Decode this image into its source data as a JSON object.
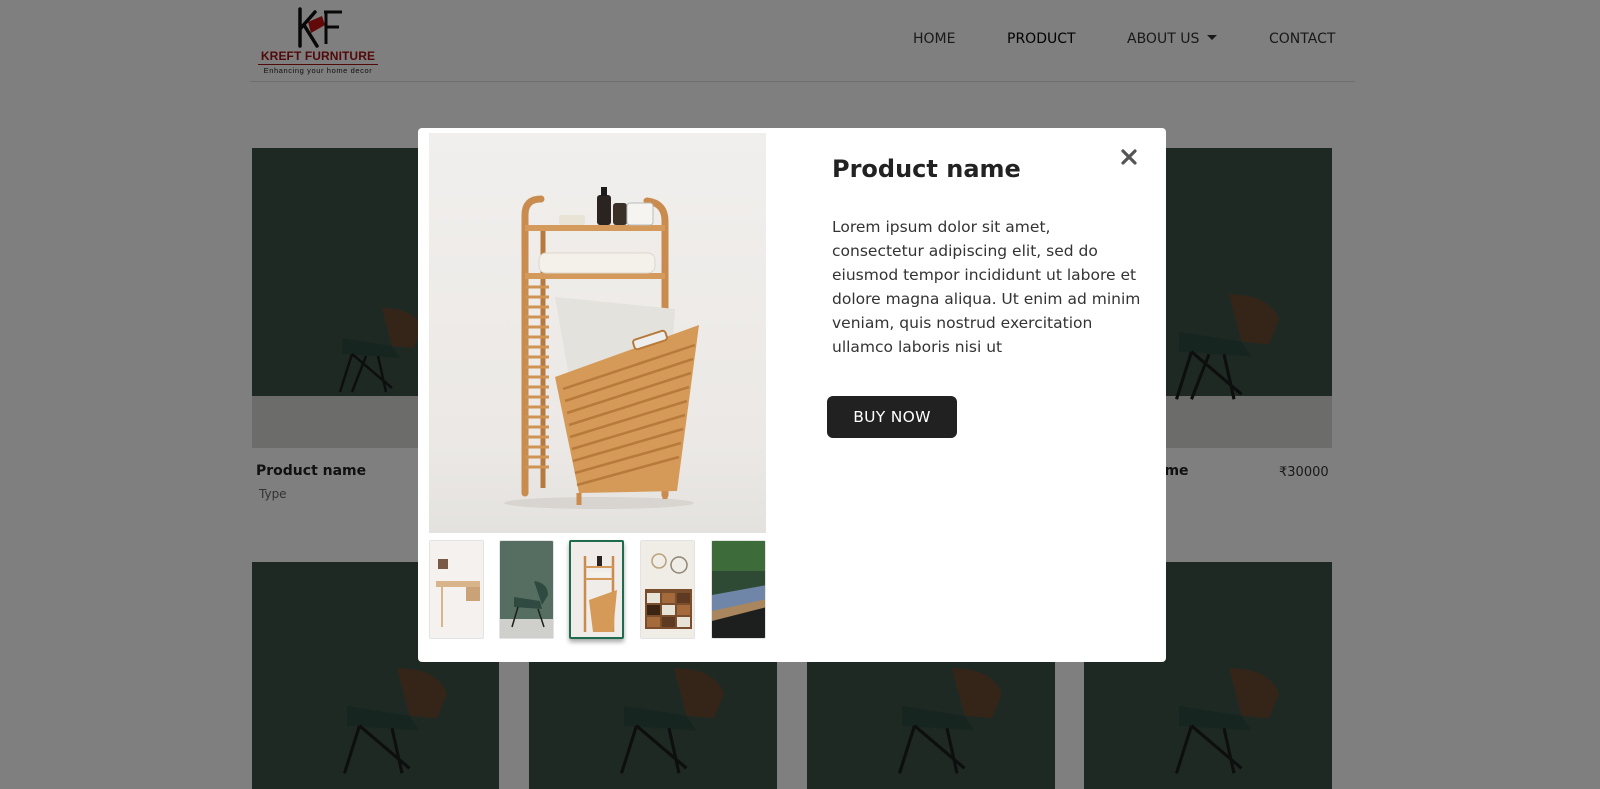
{
  "brand": {
    "name": "KREFT FURNITURE",
    "tagline": "Enhancing your home decor",
    "logo_letters": "KF",
    "brand_color": "#a51313"
  },
  "nav": {
    "items": [
      {
        "label": "HOME",
        "active": false
      },
      {
        "label": "PRODUCT",
        "active": true
      },
      {
        "label": "ABOUT US",
        "active": false,
        "dropdown": true
      },
      {
        "label": "CONTACT",
        "active": false
      }
    ]
  },
  "products": [
    {
      "name": "Product name",
      "type": "Type"
    },
    {
      "name": "ame",
      "price": "₹30000"
    }
  ],
  "modal": {
    "title": "Product name",
    "description": "Lorem ipsum dolor sit amet, consectetur adipiscing elit, sed do eiusmod tempor incididunt ut labore et dolore magna aliqua. Ut enim ad minim veniam, quis nostrud exercitation ullamco laboris nisi ut",
    "buy_label": "BUY NOW",
    "close_icon": "close-icon",
    "selected_thumbnail": 3,
    "thumbnail_count": 5
  },
  "colors": {
    "card_background": "#3d5249",
    "button": "#212121",
    "selected_thumbnail_border": "#1f6b4e"
  }
}
